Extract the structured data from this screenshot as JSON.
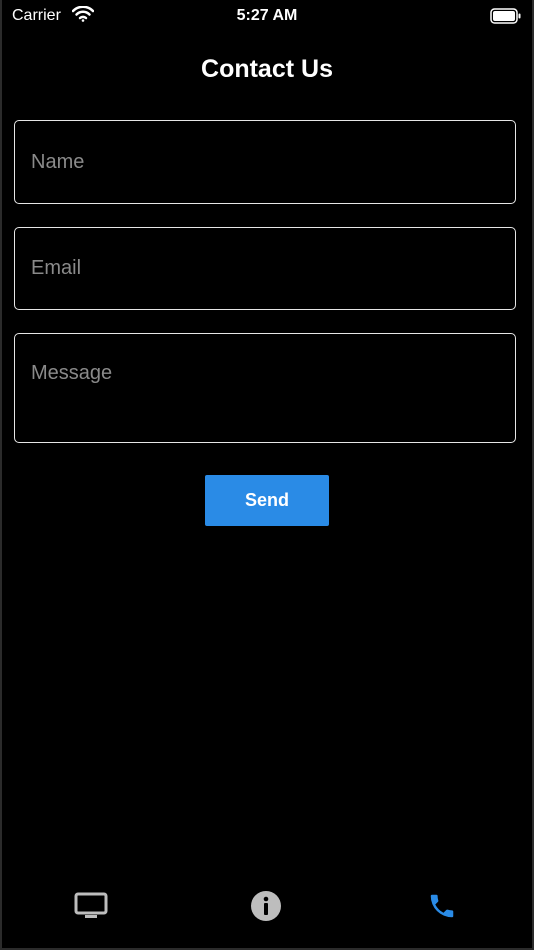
{
  "status_bar": {
    "carrier": "Carrier",
    "time": "5:27 AM"
  },
  "title": "Contact Us",
  "form": {
    "name_placeholder": "Name",
    "email_placeholder": "Email",
    "message_placeholder": "Message",
    "send_label": "Send"
  },
  "tabs": [
    {
      "icon": "tv-icon",
      "active": false
    },
    {
      "icon": "info-icon",
      "active": false
    },
    {
      "icon": "phone-icon",
      "active": true
    }
  ],
  "colors": {
    "background": "#000000",
    "accent": "#2a8be6",
    "inactive_tab": "#bdbdbd",
    "placeholder": "#8a8a8a"
  }
}
